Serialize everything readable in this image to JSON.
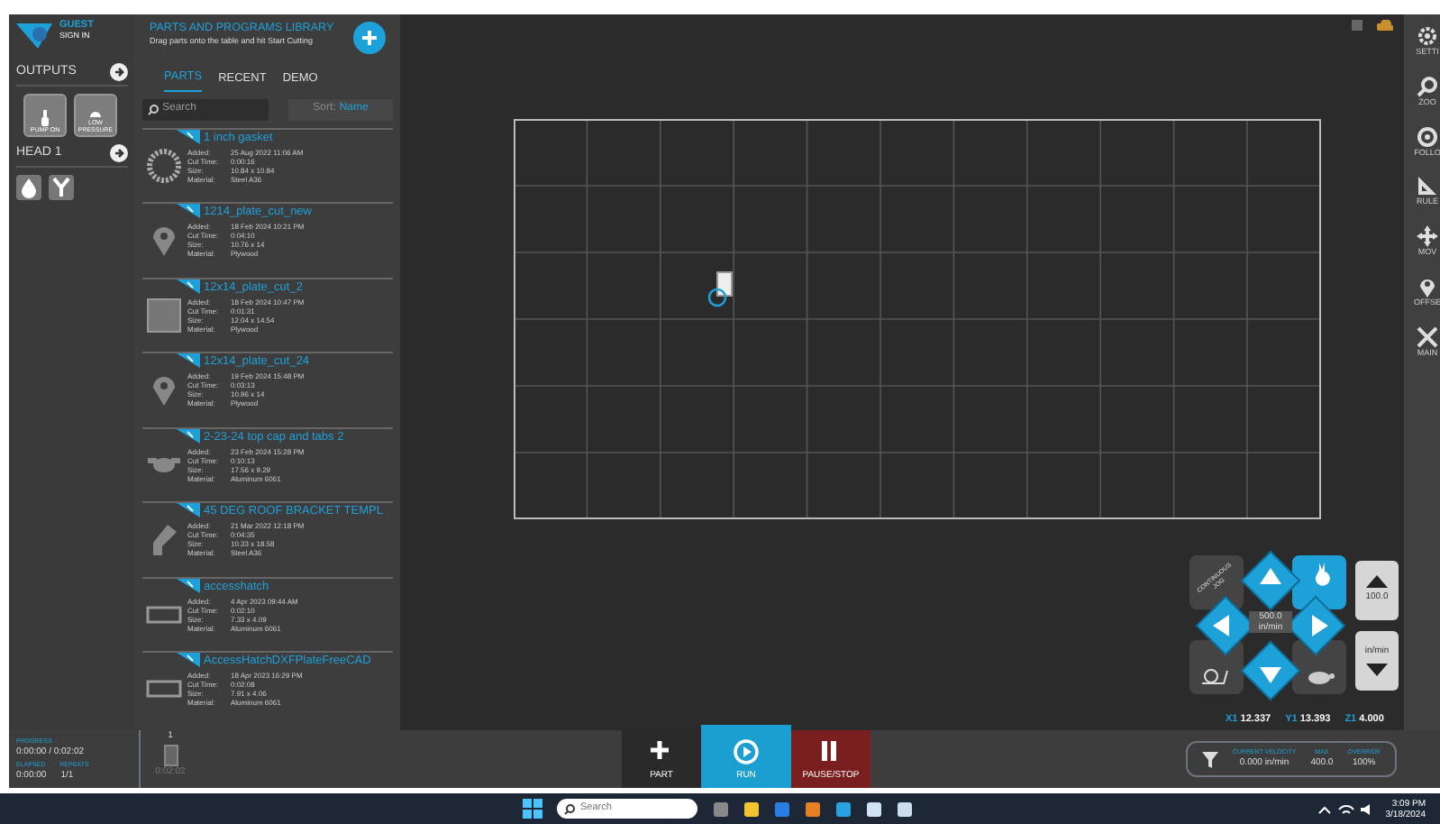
{
  "user": {
    "name": "GUEST",
    "action": "SIGN IN"
  },
  "outputs": {
    "title": "OUTPUTS",
    "buttons": [
      {
        "label": "PUMP ON",
        "kind": "pump"
      },
      {
        "label": "LOW PRESSURE",
        "kind": "gauge"
      }
    ]
  },
  "head": {
    "title": "HEAD 1",
    "buttons": [
      {
        "kind": "drop"
      },
      {
        "kind": "fork"
      }
    ]
  },
  "library": {
    "title": "PARTS AND PROGRAMS LIBRARY",
    "subtitle": "Drag parts onto the table and hit Start Cutting",
    "tabs": [
      {
        "label": "PARTS",
        "selected": true
      },
      {
        "label": "RECENT",
        "selected": false
      },
      {
        "label": "DEMO",
        "selected": false
      }
    ],
    "search": {
      "placeholder": "Search"
    },
    "sort": {
      "label": "Sort:",
      "value": "Name"
    },
    "parts": [
      {
        "name": "1 inch gasket",
        "kind": "ring",
        "fields": [
          {
            "label": "Added:",
            "value": "25 Aug 2022 11:06 AM"
          },
          {
            "label": "Cut Time:",
            "value": "0:00:16"
          },
          {
            "label": "Size:",
            "value": "10.84 x 10.84"
          },
          {
            "label": "Material:",
            "value": "Steel A36"
          }
        ]
      },
      {
        "name": "1214_plate_cut_new",
        "kind": "pin",
        "fields": [
          {
            "label": "Added:",
            "value": "18 Feb 2024 10:21 PM"
          },
          {
            "label": "Cut Time:",
            "value": "0:04:10"
          },
          {
            "label": "Size:",
            "value": "10.76 x 14"
          },
          {
            "label": "Material:",
            "value": "Plywood"
          }
        ]
      },
      {
        "name": "12x14_plate_cut_2",
        "kind": "square",
        "fields": [
          {
            "label": "Added:",
            "value": "18 Feb 2024 10:47 PM"
          },
          {
            "label": "Cut Time:",
            "value": "0:01:31"
          },
          {
            "label": "Size:",
            "value": "12.04 x 14.54"
          },
          {
            "label": "Material:",
            "value": "Plywood"
          }
        ]
      },
      {
        "name": "12x14_plate_cut_24",
        "kind": "pin",
        "fields": [
          {
            "label": "Added:",
            "value": "19 Feb 2024 15:48 PM"
          },
          {
            "label": "Cut Time:",
            "value": "0:03:13"
          },
          {
            "label": "Size:",
            "value": "10.96 x 14"
          },
          {
            "label": "Material:",
            "value": "Plywood"
          }
        ]
      },
      {
        "name": "2-23-24 top cap and tabs 2",
        "kind": "cap",
        "fields": [
          {
            "label": "Added:",
            "value": "23 Feb 2024 15:28 PM"
          },
          {
            "label": "Cut Time:",
            "value": "0:10:13"
          },
          {
            "label": "Size:",
            "value": "17.56 x 9.29"
          },
          {
            "label": "Material:",
            "value": "Aluminum 6061"
          }
        ]
      },
      {
        "name": "45 DEG ROOF BRACKET TEMPL",
        "kind": "bracket",
        "fields": [
          {
            "label": "Added:",
            "value": "21 Mar 2022 12:18 PM"
          },
          {
            "label": "Cut Time:",
            "value": "0:04:35"
          },
          {
            "label": "Size:",
            "value": "10.33 x 18.58"
          },
          {
            "label": "Material:",
            "value": "Steel A36"
          }
        ]
      },
      {
        "name": "accesshatch",
        "kind": "frame",
        "fields": [
          {
            "label": "Added:",
            "value": "4 Apr 2023 09:44 AM"
          },
          {
            "label": "Cut Time:",
            "value": "0:02:10"
          },
          {
            "label": "Size:",
            "value": "7.33 x 4.09"
          },
          {
            "label": "Material:",
            "value": "Aluminum 6061"
          }
        ]
      },
      {
        "name": "AccessHatchDXFPlateFreeCAD",
        "kind": "frame",
        "fields": [
          {
            "label": "Added:",
            "value": "18 Apr 2023 16:29 PM"
          },
          {
            "label": "Cut Time:",
            "value": "0:02:08"
          },
          {
            "label": "Size:",
            "value": "7.91 x 4.06"
          },
          {
            "label": "Material:",
            "value": "Aluminum 6061"
          }
        ]
      }
    ]
  },
  "jog": {
    "mode_label": "CONTINUOUS JOG",
    "speed": "500.0",
    "speed_unit": "in/min",
    "override": "100.0",
    "override_unit": "in/min",
    "coords": [
      {
        "axis": "X1",
        "value": "12.337"
      },
      {
        "axis": "Y1",
        "value": "13.393"
      },
      {
        "axis": "Z1",
        "value": "4.000"
      }
    ]
  },
  "sidebar": [
    {
      "label": "SETTI",
      "kind": "gear"
    },
    {
      "label": "ZOO",
      "kind": "zoom"
    },
    {
      "label": "FOLLO",
      "kind": "target"
    },
    {
      "label": "RULE",
      "kind": "ruler"
    },
    {
      "label": "MOV",
      "kind": "move"
    },
    {
      "label": "OFFSE",
      "kind": "pin"
    },
    {
      "label": "MAIN",
      "kind": "tools"
    }
  ],
  "status": {
    "progress_label": "PROGRESS",
    "progress": "0:00:00 / 0:02:02",
    "elapsed_label": "ELAPSED",
    "elapsed": "0:00:00",
    "repeats_label": "REPEATS",
    "repeats": "1/1"
  },
  "queue": {
    "count": "1",
    "time": "0:02:02"
  },
  "actions": [
    {
      "label": "PART",
      "kind": "add"
    },
    {
      "label": "RUN",
      "kind": "run"
    },
    {
      "label": "PAUSE/STOP",
      "kind": "pause"
    }
  ],
  "velocity": [
    {
      "label": "CURRENT VELOCITY",
      "value": "0.000",
      "unit": "in/min"
    },
    {
      "label": "MAX",
      "value": "400.0"
    },
    {
      "label": "OVERRIDE",
      "value": "100%"
    }
  ],
  "taskbar": {
    "search": {
      "placeholder": "Search"
    },
    "time": "3:09 PM",
    "date": "3/18/2024"
  }
}
